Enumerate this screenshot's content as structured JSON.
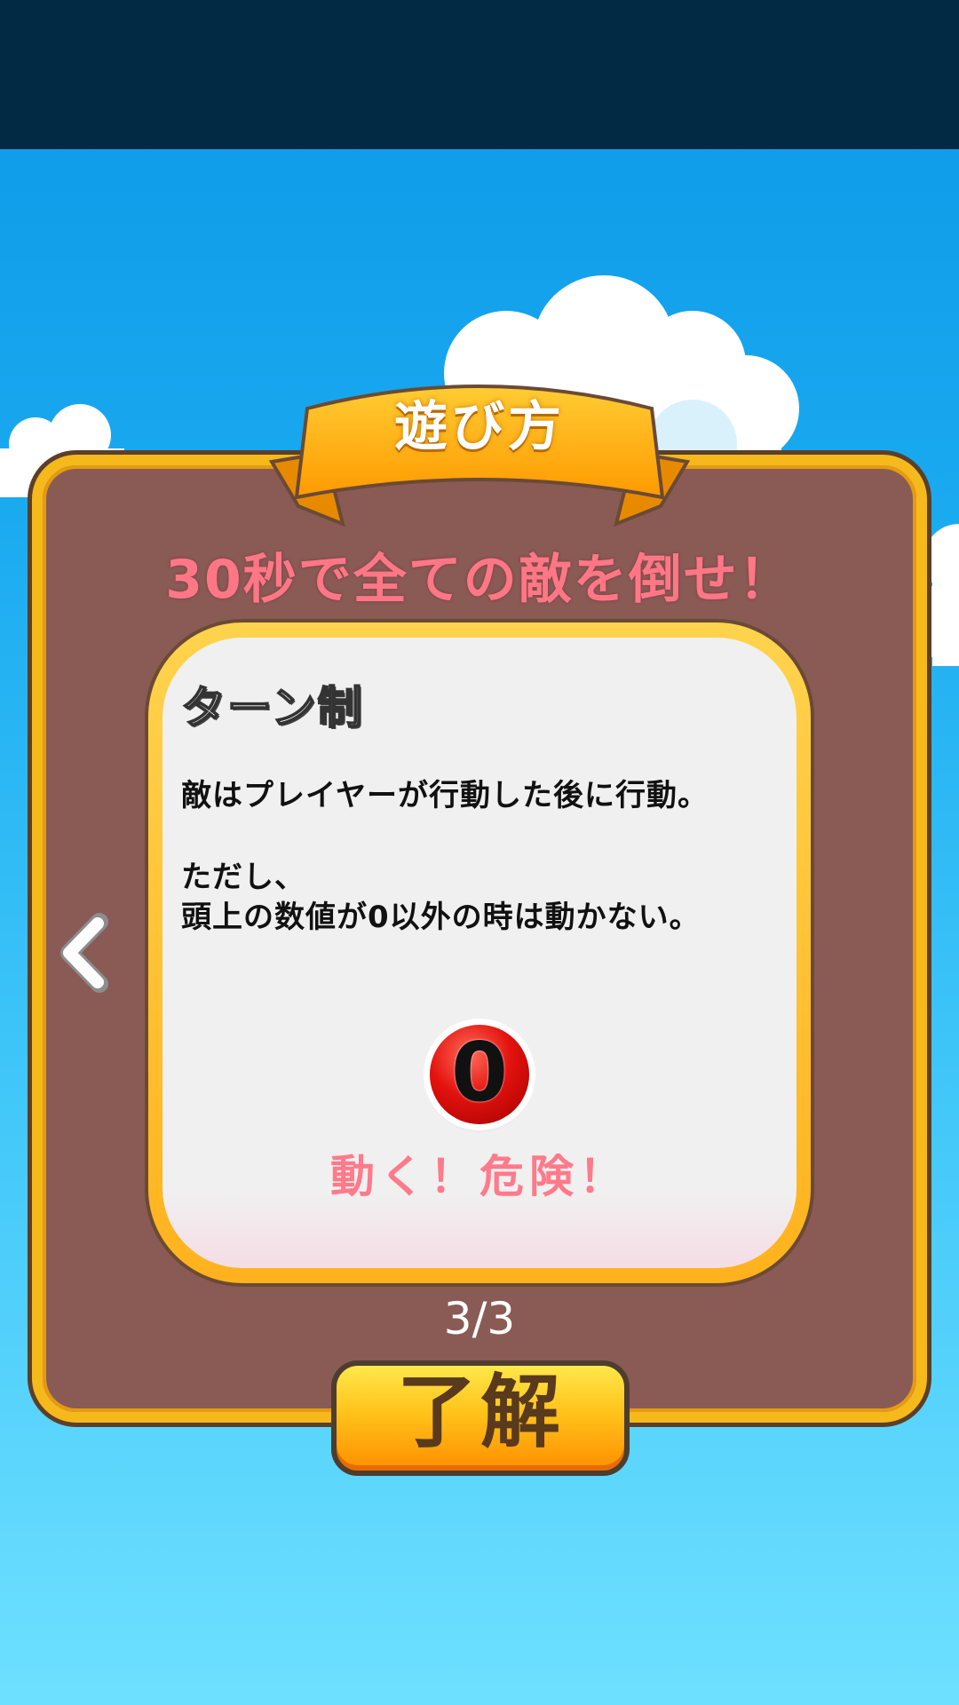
{
  "dialog": {
    "title": "遊び方",
    "headline": "30秒で全ての敵を倒せ！",
    "card": {
      "title": "ターン制",
      "line1": "敵はプレイヤーが行動した後に行動。",
      "line2": "ただし、",
      "line3": "頭上の数値が0以外の時は動かない。",
      "orb_value": "0",
      "caption": "動く！危険！"
    },
    "page_indicator": "3/3",
    "ok_button_label": "了解",
    "prev_icon": "chevron-left-icon"
  },
  "colors": {
    "status_bar": "#022a44",
    "sky_top": "#0b97e6",
    "sky_bottom": "#6ee0ff",
    "panel": "#8a5a55",
    "panel_border": "#f6b91c",
    "headline": "#ff7787",
    "caption": "#ff7a8a",
    "button": "#ffc21a"
  }
}
